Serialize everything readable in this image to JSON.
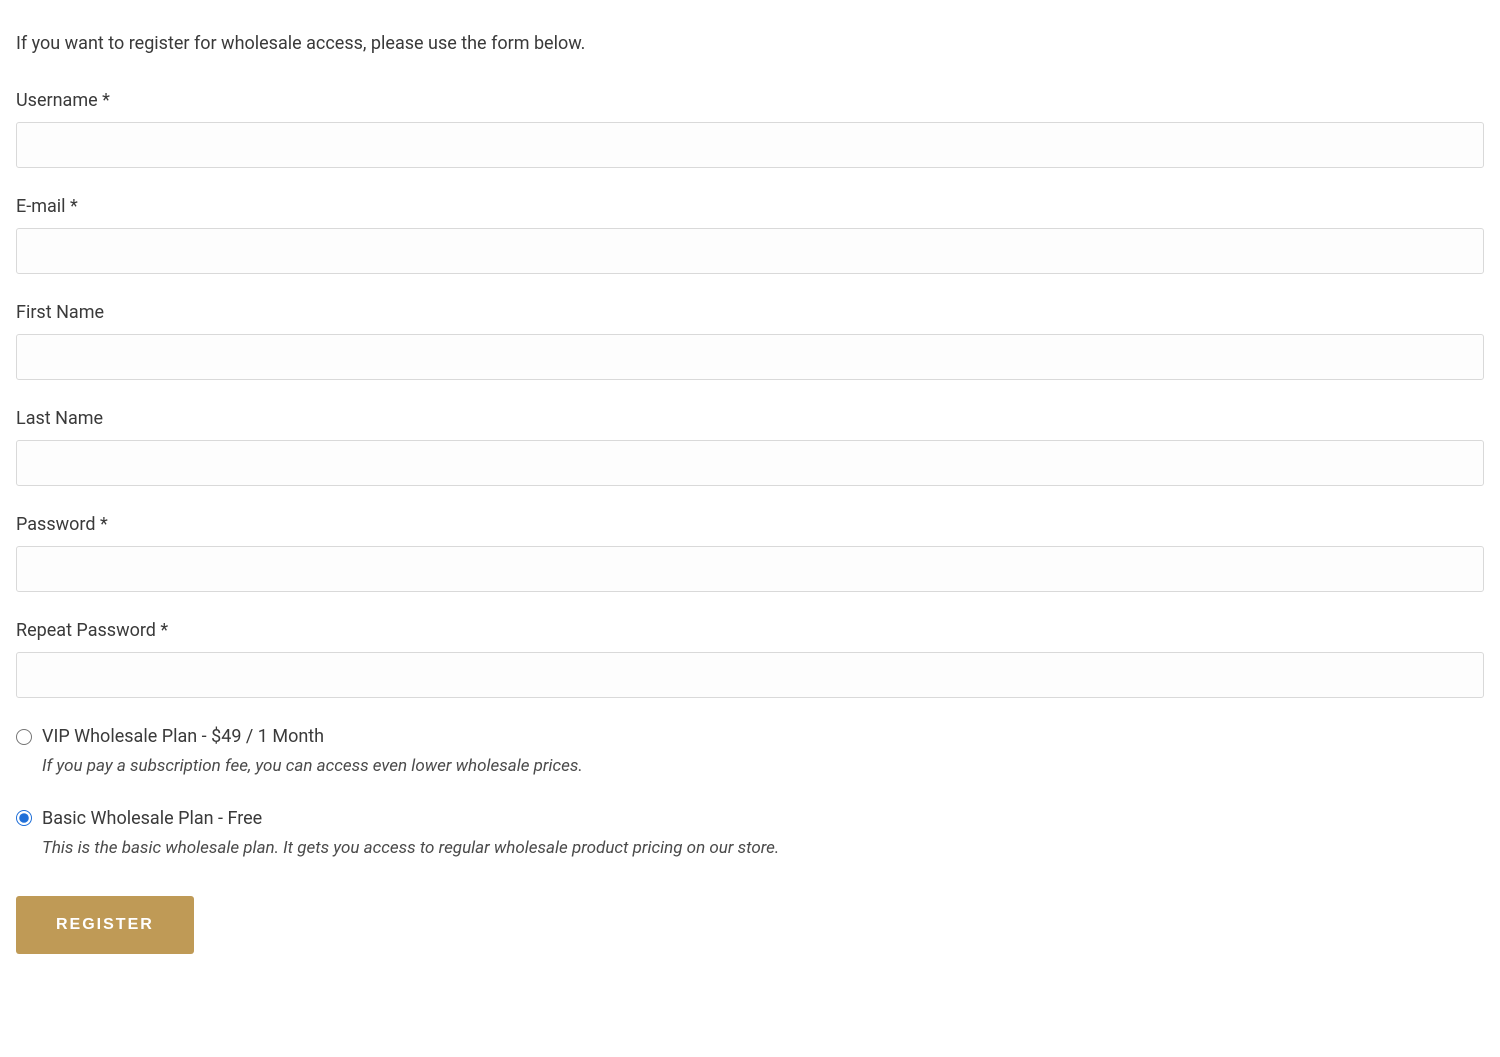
{
  "intro": "If you want to register for wholesale access, please use the form below.",
  "fields": {
    "username": {
      "label": "Username *",
      "value": ""
    },
    "email": {
      "label": "E-mail *",
      "value": ""
    },
    "first_name": {
      "label": "First Name",
      "value": ""
    },
    "last_name": {
      "label": "Last Name",
      "value": ""
    },
    "password": {
      "label": "Password *",
      "value": ""
    },
    "repeat_password": {
      "label": "Repeat Password *",
      "value": ""
    }
  },
  "plans": {
    "vip": {
      "label": "VIP Wholesale Plan - $49 / 1 Month",
      "description": "If you pay a subscription fee, you can access even lower wholesale prices.",
      "selected": false
    },
    "basic": {
      "label": "Basic Wholesale Plan - Free",
      "description": "This is the basic wholesale plan. It gets you access to regular wholesale product pricing on our store.",
      "selected": true
    }
  },
  "submit_label": "REGISTER"
}
